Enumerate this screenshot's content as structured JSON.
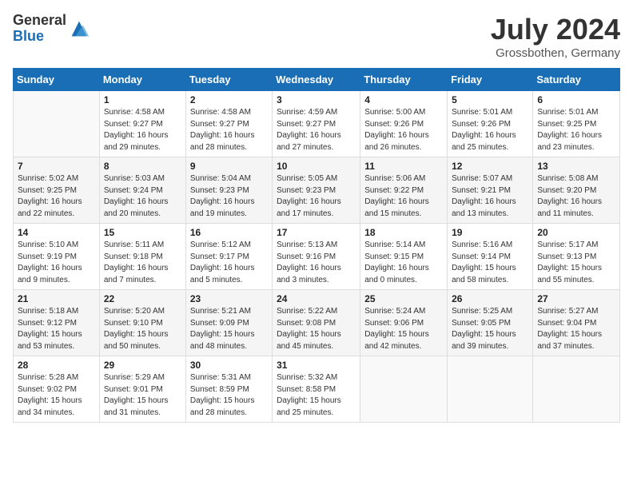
{
  "header": {
    "logo_general": "General",
    "logo_blue": "Blue",
    "month_year": "July 2024",
    "location": "Grossbothen, Germany"
  },
  "days_of_week": [
    "Sunday",
    "Monday",
    "Tuesday",
    "Wednesday",
    "Thursday",
    "Friday",
    "Saturday"
  ],
  "weeks": [
    [
      {
        "day": "",
        "info": ""
      },
      {
        "day": "1",
        "info": "Sunrise: 4:58 AM\nSunset: 9:27 PM\nDaylight: 16 hours\nand 29 minutes."
      },
      {
        "day": "2",
        "info": "Sunrise: 4:58 AM\nSunset: 9:27 PM\nDaylight: 16 hours\nand 28 minutes."
      },
      {
        "day": "3",
        "info": "Sunrise: 4:59 AM\nSunset: 9:27 PM\nDaylight: 16 hours\nand 27 minutes."
      },
      {
        "day": "4",
        "info": "Sunrise: 5:00 AM\nSunset: 9:26 PM\nDaylight: 16 hours\nand 26 minutes."
      },
      {
        "day": "5",
        "info": "Sunrise: 5:01 AM\nSunset: 9:26 PM\nDaylight: 16 hours\nand 25 minutes."
      },
      {
        "day": "6",
        "info": "Sunrise: 5:01 AM\nSunset: 9:25 PM\nDaylight: 16 hours\nand 23 minutes."
      }
    ],
    [
      {
        "day": "7",
        "info": "Sunrise: 5:02 AM\nSunset: 9:25 PM\nDaylight: 16 hours\nand 22 minutes."
      },
      {
        "day": "8",
        "info": "Sunrise: 5:03 AM\nSunset: 9:24 PM\nDaylight: 16 hours\nand 20 minutes."
      },
      {
        "day": "9",
        "info": "Sunrise: 5:04 AM\nSunset: 9:23 PM\nDaylight: 16 hours\nand 19 minutes."
      },
      {
        "day": "10",
        "info": "Sunrise: 5:05 AM\nSunset: 9:23 PM\nDaylight: 16 hours\nand 17 minutes."
      },
      {
        "day": "11",
        "info": "Sunrise: 5:06 AM\nSunset: 9:22 PM\nDaylight: 16 hours\nand 15 minutes."
      },
      {
        "day": "12",
        "info": "Sunrise: 5:07 AM\nSunset: 9:21 PM\nDaylight: 16 hours\nand 13 minutes."
      },
      {
        "day": "13",
        "info": "Sunrise: 5:08 AM\nSunset: 9:20 PM\nDaylight: 16 hours\nand 11 minutes."
      }
    ],
    [
      {
        "day": "14",
        "info": "Sunrise: 5:10 AM\nSunset: 9:19 PM\nDaylight: 16 hours\nand 9 minutes."
      },
      {
        "day": "15",
        "info": "Sunrise: 5:11 AM\nSunset: 9:18 PM\nDaylight: 16 hours\nand 7 minutes."
      },
      {
        "day": "16",
        "info": "Sunrise: 5:12 AM\nSunset: 9:17 PM\nDaylight: 16 hours\nand 5 minutes."
      },
      {
        "day": "17",
        "info": "Sunrise: 5:13 AM\nSunset: 9:16 PM\nDaylight: 16 hours\nand 3 minutes."
      },
      {
        "day": "18",
        "info": "Sunrise: 5:14 AM\nSunset: 9:15 PM\nDaylight: 16 hours\nand 0 minutes."
      },
      {
        "day": "19",
        "info": "Sunrise: 5:16 AM\nSunset: 9:14 PM\nDaylight: 15 hours\nand 58 minutes."
      },
      {
        "day": "20",
        "info": "Sunrise: 5:17 AM\nSunset: 9:13 PM\nDaylight: 15 hours\nand 55 minutes."
      }
    ],
    [
      {
        "day": "21",
        "info": "Sunrise: 5:18 AM\nSunset: 9:12 PM\nDaylight: 15 hours\nand 53 minutes."
      },
      {
        "day": "22",
        "info": "Sunrise: 5:20 AM\nSunset: 9:10 PM\nDaylight: 15 hours\nand 50 minutes."
      },
      {
        "day": "23",
        "info": "Sunrise: 5:21 AM\nSunset: 9:09 PM\nDaylight: 15 hours\nand 48 minutes."
      },
      {
        "day": "24",
        "info": "Sunrise: 5:22 AM\nSunset: 9:08 PM\nDaylight: 15 hours\nand 45 minutes."
      },
      {
        "day": "25",
        "info": "Sunrise: 5:24 AM\nSunset: 9:06 PM\nDaylight: 15 hours\nand 42 minutes."
      },
      {
        "day": "26",
        "info": "Sunrise: 5:25 AM\nSunset: 9:05 PM\nDaylight: 15 hours\nand 39 minutes."
      },
      {
        "day": "27",
        "info": "Sunrise: 5:27 AM\nSunset: 9:04 PM\nDaylight: 15 hours\nand 37 minutes."
      }
    ],
    [
      {
        "day": "28",
        "info": "Sunrise: 5:28 AM\nSunset: 9:02 PM\nDaylight: 15 hours\nand 34 minutes."
      },
      {
        "day": "29",
        "info": "Sunrise: 5:29 AM\nSunset: 9:01 PM\nDaylight: 15 hours\nand 31 minutes."
      },
      {
        "day": "30",
        "info": "Sunrise: 5:31 AM\nSunset: 8:59 PM\nDaylight: 15 hours\nand 28 minutes."
      },
      {
        "day": "31",
        "info": "Sunrise: 5:32 AM\nSunset: 8:58 PM\nDaylight: 15 hours\nand 25 minutes."
      },
      {
        "day": "",
        "info": ""
      },
      {
        "day": "",
        "info": ""
      },
      {
        "day": "",
        "info": ""
      }
    ]
  ]
}
